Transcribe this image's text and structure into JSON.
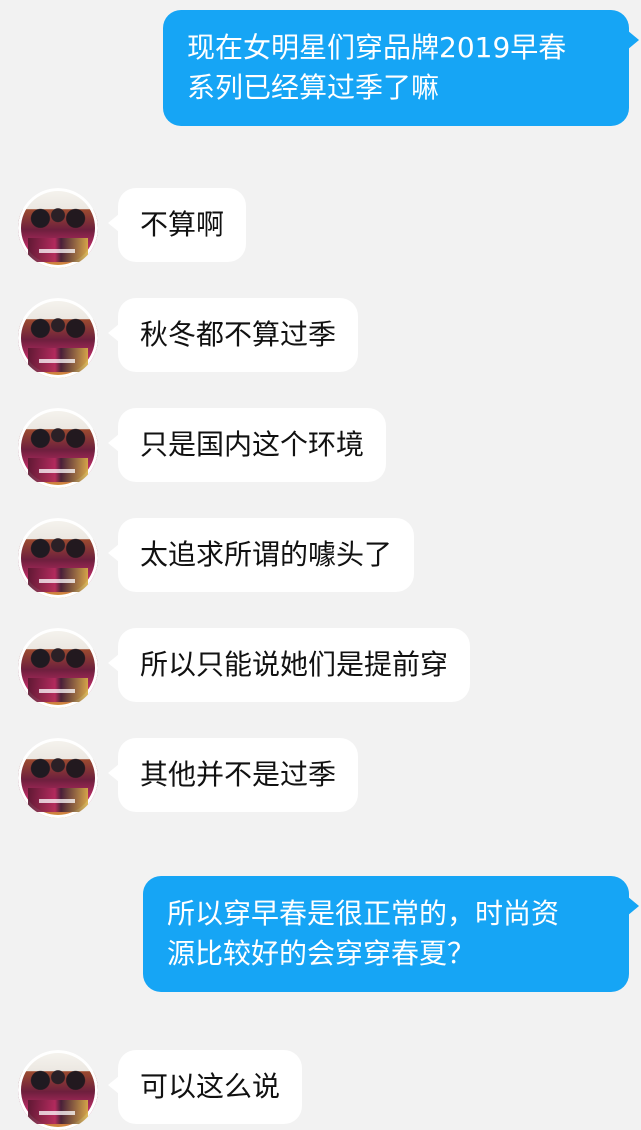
{
  "messages": [
    {
      "side": "out",
      "text": "现在女明星们穿品牌2019早春\n系列已经算过季了嘛"
    },
    {
      "side": "in",
      "text": "不算啊"
    },
    {
      "side": "in",
      "text": "秋冬都不算过季"
    },
    {
      "side": "in",
      "text": "只是国内这个环境"
    },
    {
      "side": "in",
      "text": "太追求所谓的噱头了"
    },
    {
      "side": "in",
      "text": "所以只能说她们是提前穿"
    },
    {
      "side": "in",
      "text": "其他并不是过季"
    },
    {
      "side": "out",
      "text": "所以穿早春是很正常的，时尚资\n源比较好的会穿穿春夏？"
    },
    {
      "side": "in",
      "text": "可以这么说"
    }
  ],
  "colors": {
    "background": "#f2f2f2",
    "outgoing_bubble": "#16a5f5",
    "incoming_bubble": "#ffffff"
  }
}
